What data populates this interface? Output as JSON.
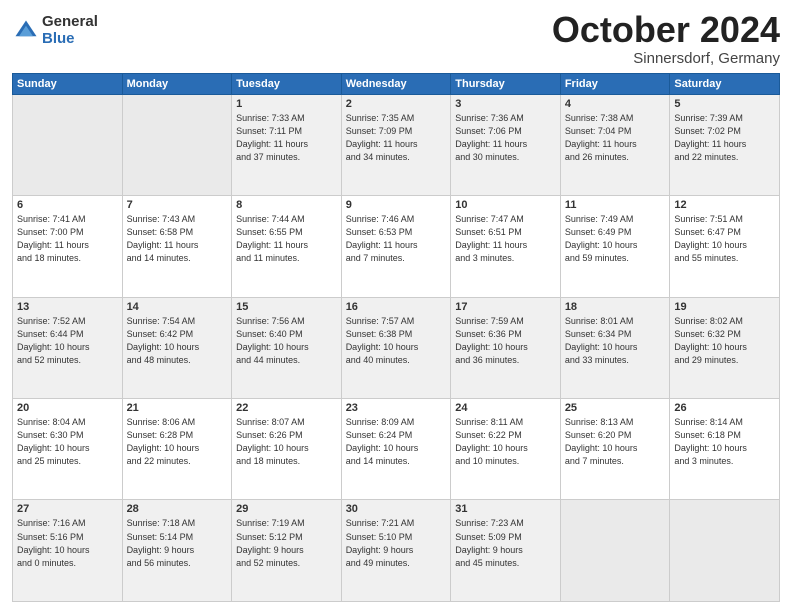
{
  "logo": {
    "general": "General",
    "blue": "Blue"
  },
  "title": {
    "month": "October 2024",
    "location": "Sinnersdorf, Germany"
  },
  "headers": [
    "Sunday",
    "Monday",
    "Tuesday",
    "Wednesday",
    "Thursday",
    "Friday",
    "Saturday"
  ],
  "weeks": [
    [
      {
        "day": "",
        "info": ""
      },
      {
        "day": "",
        "info": ""
      },
      {
        "day": "1",
        "info": "Sunrise: 7:33 AM\nSunset: 7:11 PM\nDaylight: 11 hours\nand 37 minutes."
      },
      {
        "day": "2",
        "info": "Sunrise: 7:35 AM\nSunset: 7:09 PM\nDaylight: 11 hours\nand 34 minutes."
      },
      {
        "day": "3",
        "info": "Sunrise: 7:36 AM\nSunset: 7:06 PM\nDaylight: 11 hours\nand 30 minutes."
      },
      {
        "day": "4",
        "info": "Sunrise: 7:38 AM\nSunset: 7:04 PM\nDaylight: 11 hours\nand 26 minutes."
      },
      {
        "day": "5",
        "info": "Sunrise: 7:39 AM\nSunset: 7:02 PM\nDaylight: 11 hours\nand 22 minutes."
      }
    ],
    [
      {
        "day": "6",
        "info": "Sunrise: 7:41 AM\nSunset: 7:00 PM\nDaylight: 11 hours\nand 18 minutes."
      },
      {
        "day": "7",
        "info": "Sunrise: 7:43 AM\nSunset: 6:58 PM\nDaylight: 11 hours\nand 14 minutes."
      },
      {
        "day": "8",
        "info": "Sunrise: 7:44 AM\nSunset: 6:55 PM\nDaylight: 11 hours\nand 11 minutes."
      },
      {
        "day": "9",
        "info": "Sunrise: 7:46 AM\nSunset: 6:53 PM\nDaylight: 11 hours\nand 7 minutes."
      },
      {
        "day": "10",
        "info": "Sunrise: 7:47 AM\nSunset: 6:51 PM\nDaylight: 11 hours\nand 3 minutes."
      },
      {
        "day": "11",
        "info": "Sunrise: 7:49 AM\nSunset: 6:49 PM\nDaylight: 10 hours\nand 59 minutes."
      },
      {
        "day": "12",
        "info": "Sunrise: 7:51 AM\nSunset: 6:47 PM\nDaylight: 10 hours\nand 55 minutes."
      }
    ],
    [
      {
        "day": "13",
        "info": "Sunrise: 7:52 AM\nSunset: 6:44 PM\nDaylight: 10 hours\nand 52 minutes."
      },
      {
        "day": "14",
        "info": "Sunrise: 7:54 AM\nSunset: 6:42 PM\nDaylight: 10 hours\nand 48 minutes."
      },
      {
        "day": "15",
        "info": "Sunrise: 7:56 AM\nSunset: 6:40 PM\nDaylight: 10 hours\nand 44 minutes."
      },
      {
        "day": "16",
        "info": "Sunrise: 7:57 AM\nSunset: 6:38 PM\nDaylight: 10 hours\nand 40 minutes."
      },
      {
        "day": "17",
        "info": "Sunrise: 7:59 AM\nSunset: 6:36 PM\nDaylight: 10 hours\nand 36 minutes."
      },
      {
        "day": "18",
        "info": "Sunrise: 8:01 AM\nSunset: 6:34 PM\nDaylight: 10 hours\nand 33 minutes."
      },
      {
        "day": "19",
        "info": "Sunrise: 8:02 AM\nSunset: 6:32 PM\nDaylight: 10 hours\nand 29 minutes."
      }
    ],
    [
      {
        "day": "20",
        "info": "Sunrise: 8:04 AM\nSunset: 6:30 PM\nDaylight: 10 hours\nand 25 minutes."
      },
      {
        "day": "21",
        "info": "Sunrise: 8:06 AM\nSunset: 6:28 PM\nDaylight: 10 hours\nand 22 minutes."
      },
      {
        "day": "22",
        "info": "Sunrise: 8:07 AM\nSunset: 6:26 PM\nDaylight: 10 hours\nand 18 minutes."
      },
      {
        "day": "23",
        "info": "Sunrise: 8:09 AM\nSunset: 6:24 PM\nDaylight: 10 hours\nand 14 minutes."
      },
      {
        "day": "24",
        "info": "Sunrise: 8:11 AM\nSunset: 6:22 PM\nDaylight: 10 hours\nand 10 minutes."
      },
      {
        "day": "25",
        "info": "Sunrise: 8:13 AM\nSunset: 6:20 PM\nDaylight: 10 hours\nand 7 minutes."
      },
      {
        "day": "26",
        "info": "Sunrise: 8:14 AM\nSunset: 6:18 PM\nDaylight: 10 hours\nand 3 minutes."
      }
    ],
    [
      {
        "day": "27",
        "info": "Sunrise: 7:16 AM\nSunset: 5:16 PM\nDaylight: 10 hours\nand 0 minutes."
      },
      {
        "day": "28",
        "info": "Sunrise: 7:18 AM\nSunset: 5:14 PM\nDaylight: 9 hours\nand 56 minutes."
      },
      {
        "day": "29",
        "info": "Sunrise: 7:19 AM\nSunset: 5:12 PM\nDaylight: 9 hours\nand 52 minutes."
      },
      {
        "day": "30",
        "info": "Sunrise: 7:21 AM\nSunset: 5:10 PM\nDaylight: 9 hours\nand 49 minutes."
      },
      {
        "day": "31",
        "info": "Sunrise: 7:23 AM\nSunset: 5:09 PM\nDaylight: 9 hours\nand 45 minutes."
      },
      {
        "day": "",
        "info": ""
      },
      {
        "day": "",
        "info": ""
      }
    ]
  ]
}
